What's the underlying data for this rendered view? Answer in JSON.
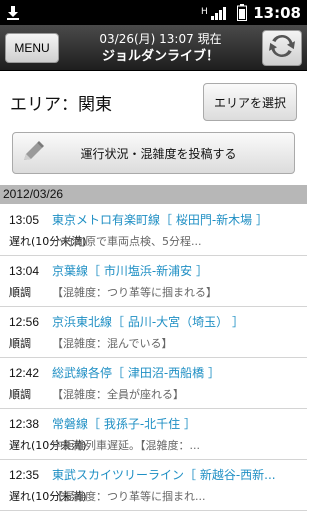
{
  "status_bar": {
    "time": "13:08",
    "icons": [
      "download-icon",
      "signal-hplus-icon",
      "battery-icon"
    ],
    "network": "H"
  },
  "header": {
    "menu_label": "MENU",
    "subtitle": "03/26(月) 13:07 現在",
    "title": "ジョルダンライブ！",
    "refresh_icon": "refresh-icon"
  },
  "area": {
    "label": "エリア：関東",
    "select_button": "エリアを選択"
  },
  "post_button": {
    "label": "運行状況・混雑度を投稿する",
    "icon": "pencil-icon"
  },
  "date_header": "2012/03/26",
  "posts": [
    {
      "time": "13:05",
      "line": "東京メトロ有楽町線［ 桜田門-新木場 ］",
      "status": "遅れ(10分未満)",
      "detail": "小竹向原で車両点検、5分程..."
    },
    {
      "time": "13:04",
      "line": "京葉線［ 市川塩浜-新浦安 ］",
      "status": "順調",
      "detail": "【混雑度：つり革等に掴まれる】"
    },
    {
      "time": "12:56",
      "line": "京浜東北線［ 品川-大宮（埼玉） ］",
      "status": "順調",
      "detail": "【混雑度：混んでいる】"
    },
    {
      "time": "12:42",
      "line": "総武線各停［ 津田沼-西船橋 ］",
      "status": "順調",
      "detail": "【混雑度：全員が座れる】"
    },
    {
      "time": "12:38",
      "line": "常磐線［ 我孫子-北千住 ］",
      "status": "遅れ(10分未満)",
      "detail": "中距離列車遅延。【混雑度：..."
    },
    {
      "time": "12:35",
      "line": "東武スカイツリーライン［ 新越谷-西新...",
      "status": "遅れ(10分未満)",
      "detail": "【混雑度：つり革等に掴まれ..."
    }
  ],
  "colors": {
    "line_link": "#1f8fc4",
    "header_bg": "#2a2a2a",
    "date_bg": "#b7b7b7"
  }
}
